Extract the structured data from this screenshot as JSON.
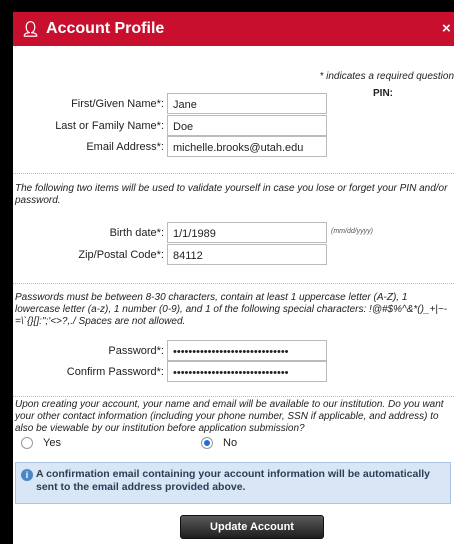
{
  "header": {
    "title": "Account Profile",
    "icon": "person-icon",
    "close_label": "×",
    "color": "#c8102e"
  },
  "required_note": "* indicates a required question",
  "pin_label": "PIN:",
  "identity": {
    "first_name_label": "First/Given Name*:",
    "first_name_value": "Jane",
    "last_name_label": "Last or Family Name*:",
    "last_name_value": "Doe",
    "email_label": "Email Address*:",
    "email_value": "michelle.brooks@utah.edu"
  },
  "validation_text": "The following two items will be used to validate yourself in case you lose or forget your PIN and/or password.",
  "validation": {
    "birth_date_label": "Birth date*:",
    "birth_date_value": "1/1/1989",
    "birth_date_hint": "(mm/dd/yyyy)",
    "zip_label": "Zip/Postal Code*:",
    "zip_value": "84112"
  },
  "password_rules": "Passwords must be between 8-30 characters, contain at least 1 uppercase letter (A-Z), 1 lowercase letter (a-z), 1 number (0-9), and 1 of the following special characters: !@#$%^&*()_+|~-=\\`{}[]:\";'<>?,./ Spaces are not allowed.",
  "passwords": {
    "password_label": "Password*:",
    "password_value": "••••••••••••••••••••••••••••••",
    "confirm_label": "Confirm Password*:",
    "confirm_value": "••••••••••••••••••••••••••••••"
  },
  "sharing_question": "Upon creating your account, your name and email will be available to our institution. Do you want your other contact information (including your phone number, SSN if applicable, and address) to also be viewable by our institution before application submission?",
  "sharing_options": {
    "yes_label": "Yes",
    "no_label": "No",
    "selected": "No"
  },
  "info_message": "A confirmation email containing your account information will be automatically sent to the email address provided above.",
  "submit_label": "Update Account"
}
